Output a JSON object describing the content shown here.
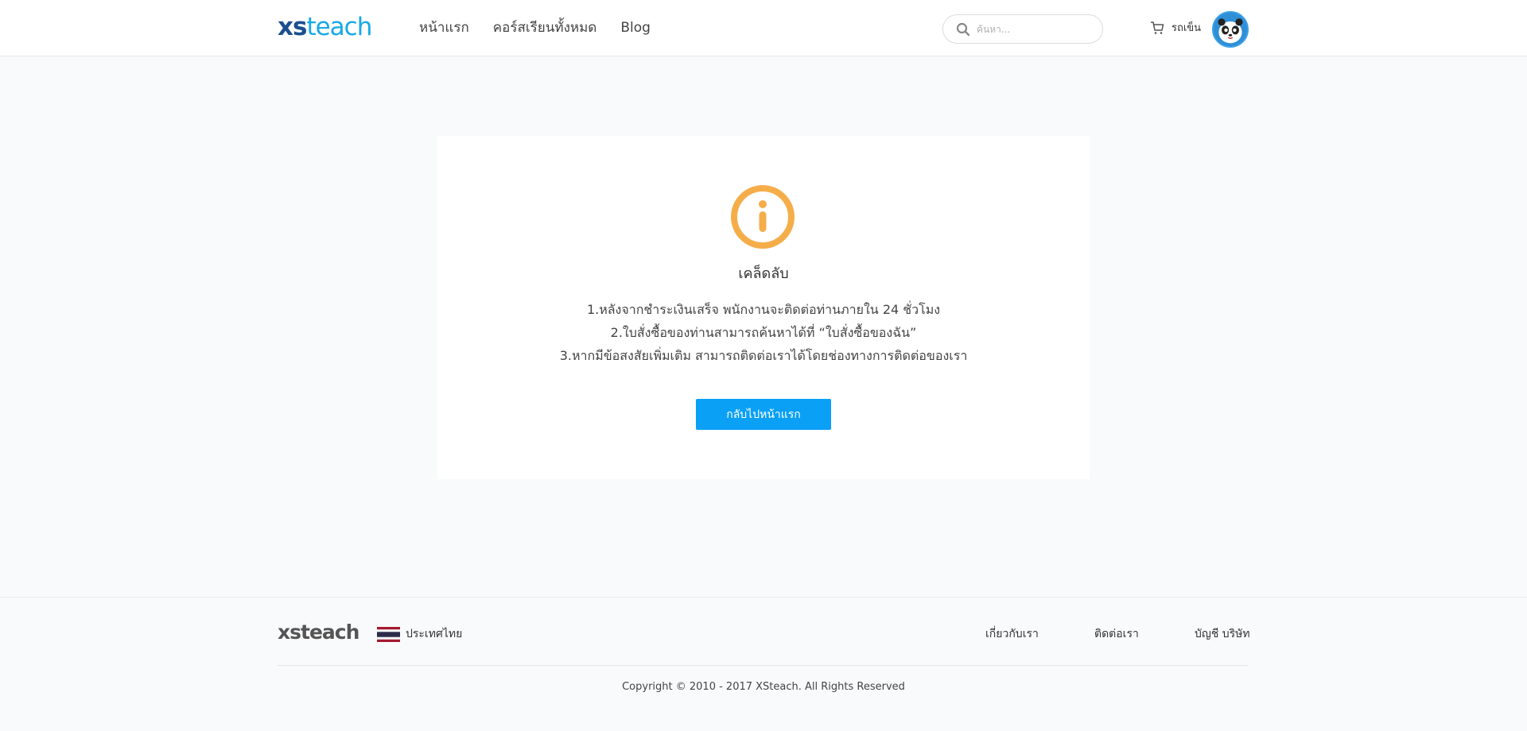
{
  "header": {
    "logo_xs": "xs",
    "logo_teach": "teach",
    "nav": [
      {
        "label": "หน้าแรก"
      },
      {
        "label": "คอร์สเรียนทั้งหมด"
      },
      {
        "label": "Blog"
      }
    ],
    "search": {
      "placeholder": "ค้นหา..."
    },
    "cart": {
      "label": "รถเข็น",
      "icon": "cart-icon"
    },
    "avatar": {
      "icon": "panda-avatar"
    }
  },
  "card": {
    "icon": "info-circle-icon",
    "title": "เคล็ดลับ",
    "lines": [
      "1.หลังจากชำระเงินเสร็จ พนักงานจะติดต่อท่านภายใน 24 ชั่วโมง",
      "2.ใบสั่งซื้อของท่านสามารถค้นหาได้ที่   “ใบสั่งซื้อของฉัน”",
      "3.หากมีข้อสงสัยเพิ่มเติม สามารถติดต่อเราได้โดยช่องทางการติดต่อของเรา"
    ],
    "button_label": "กลับไปหน้าแรก"
  },
  "footer": {
    "logo": "xsteach",
    "country": "ประเทศไทย",
    "links": [
      {
        "label": "เกี่ยวกับเรา"
      },
      {
        "label": "ติดต่อเรา"
      },
      {
        "label": "บัญชี บริษัท"
      }
    ],
    "copyright": "Copyright © 2010 - 2017 XSteach. All Rights Reserved"
  },
  "colors": {
    "accent": "#0aa0f5",
    "logo_dark": "#1b4f8f",
    "logo_light": "#17a9e6",
    "info_icon": "#f5ad4a",
    "page_bg": "#f9fafb"
  }
}
